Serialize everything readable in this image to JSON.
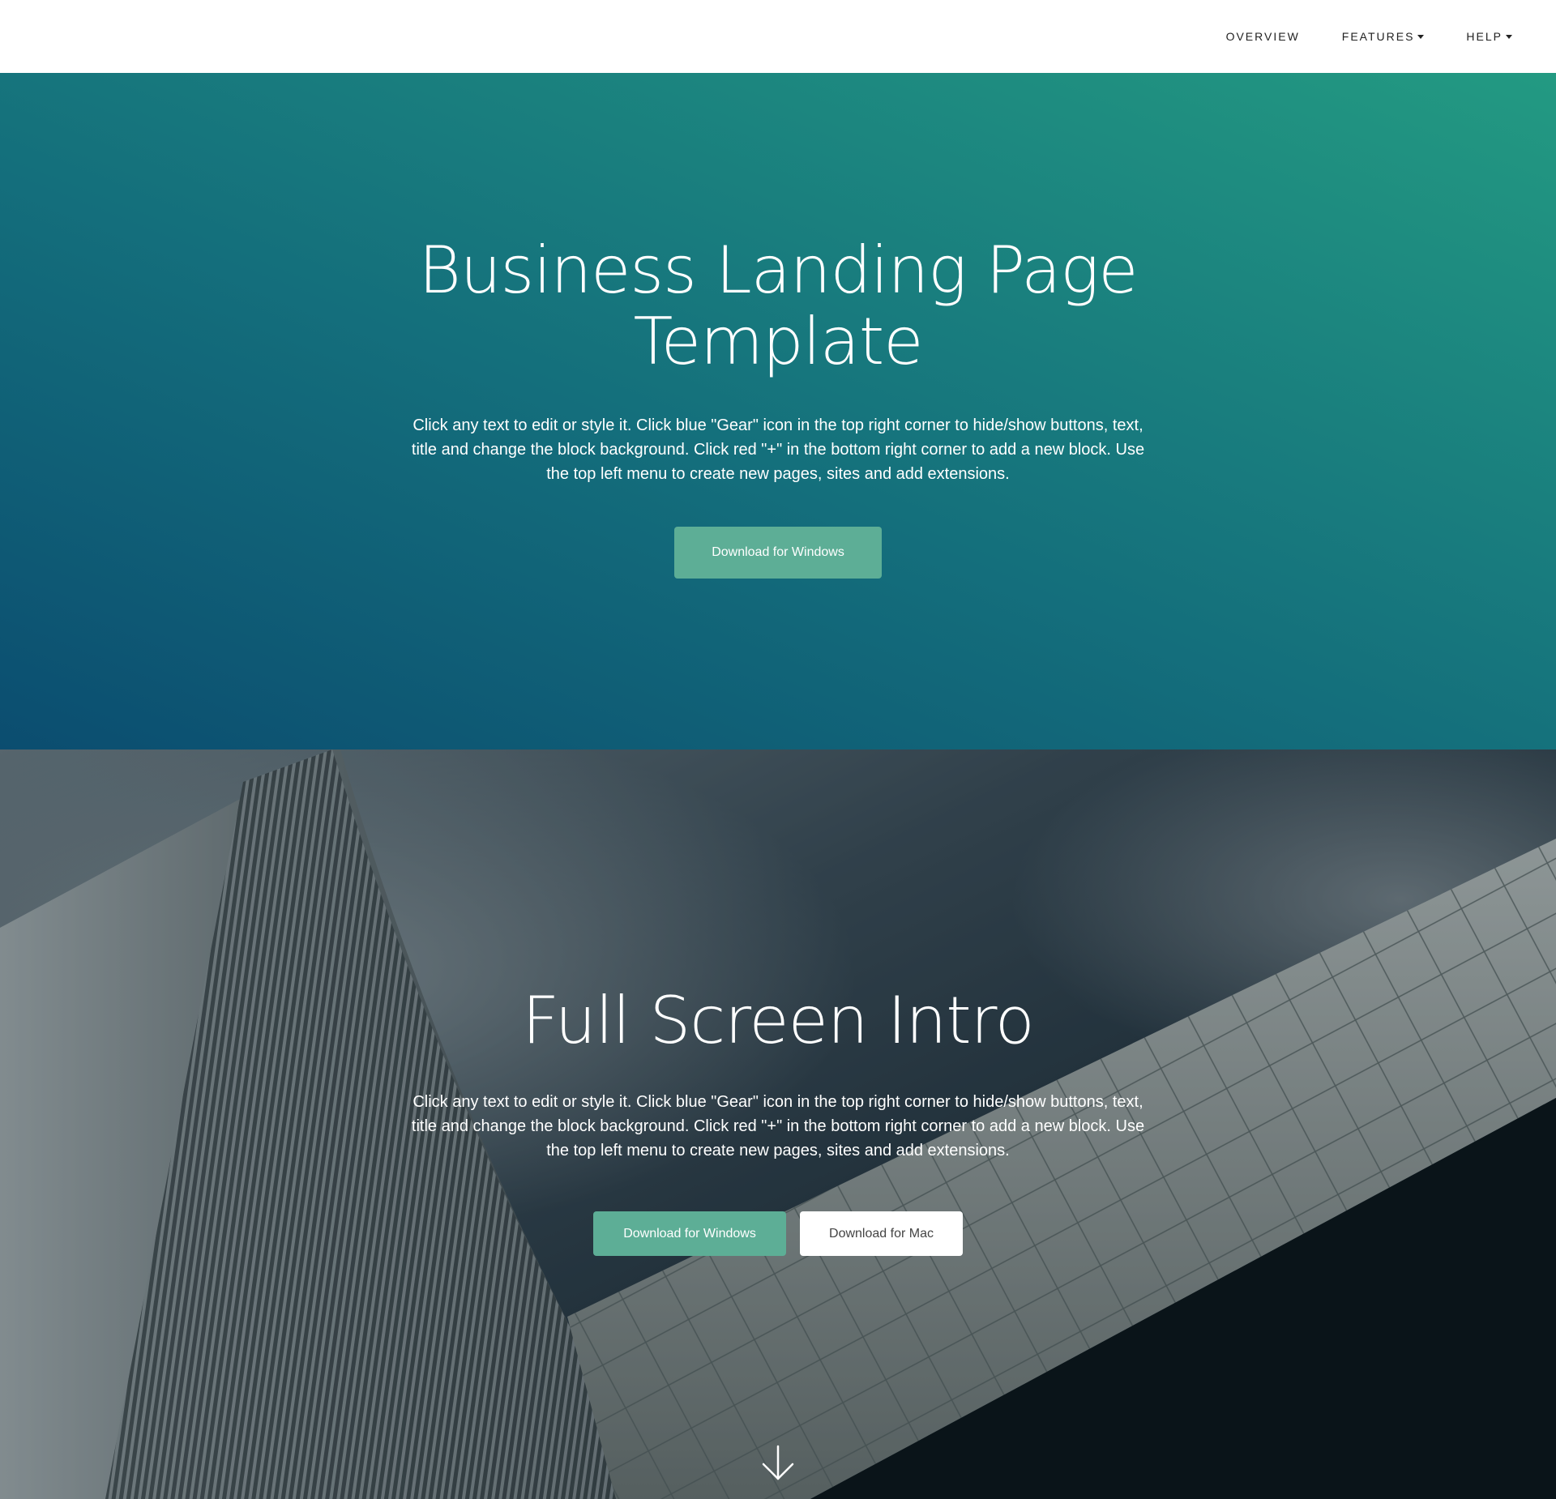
{
  "nav": {
    "items": [
      {
        "label": "OVERVIEW",
        "has_dropdown": false
      },
      {
        "label": "FEATURES",
        "has_dropdown": true
      },
      {
        "label": "HELP",
        "has_dropdown": true
      }
    ]
  },
  "hero": {
    "title": "Business Landing Page Template",
    "text": "Click any text to edit or style it. Click blue \"Gear\" icon in the top right corner to hide/show buttons, text, title and change the block background. Click red \"+\" in the bottom right corner to add a new block. Use the top left menu to create new pages, sites and add extensions.",
    "button_label": "Download for Windows"
  },
  "intro": {
    "title": "Full Screen Intro",
    "text": "Click any text to edit or style it. Click blue \"Gear\" icon in the top right corner to hide/show buttons, text, title and change the block background. Click red \"+\" in the bottom right corner to add a new block. Use the top left menu to create new pages, sites and add extensions.",
    "button_windows_label": "Download for Windows",
    "button_mac_label": "Download for Mac",
    "scroll_icon": "arrow-down-icon"
  },
  "colors": {
    "nav_bg": "#ffffff",
    "nav_text": "#222222",
    "hero_gradient_start": "#0b4d70",
    "hero_gradient_end": "#239a82",
    "button_primary": "#5dae96",
    "button_secondary": "#ffffff"
  }
}
